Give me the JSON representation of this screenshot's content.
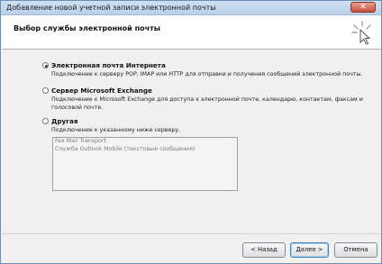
{
  "window": {
    "title": "Добавление новой учетной записи электронной почты",
    "close_label": "✕"
  },
  "header": {
    "title": "Выбор службы электронной почты",
    "icon": "wizard-cursor-icon"
  },
  "options": [
    {
      "label": "Электронная почта Интернета",
      "description": "Подключение к серверу POP, IMAP или HTTP для отправки и получения сообщений электронной почты.",
      "checked": true
    },
    {
      "label": "Сервер Microsoft Exchange",
      "description": "Подключение к Microsoft Exchange для доступа к электронной почте, календарю, контактам, факсам и голосовой почте.",
      "checked": false
    },
    {
      "label": "Другая",
      "description": "Подключение к указанному ниже серверу.",
      "checked": false
    }
  ],
  "other_servers": [
    "Fax Mail Transport",
    "Служба Outlook Mobile (текстовые сообщения)"
  ],
  "buttons": {
    "back": "< Назад",
    "next": "Далее >",
    "cancel": "Отмена"
  }
}
